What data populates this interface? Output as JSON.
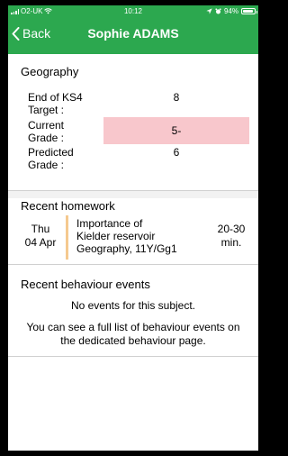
{
  "status_bar": {
    "carrier": "O2-UK",
    "time": "10:12",
    "battery": "94%",
    "battery_level": 0.94
  },
  "nav": {
    "back_label": "Back",
    "title": "Sophie ADAMS"
  },
  "geography": {
    "title": "Geography",
    "rows": [
      {
        "label_line1": "End of KS4",
        "label_line2": "Target :",
        "value": "8",
        "highlight": false
      },
      {
        "label_line1": "Current",
        "label_line2": "Grade :",
        "value": "5-",
        "highlight": true
      },
      {
        "label_line1": "Predicted",
        "label_line2": "Grade :",
        "value": "6",
        "highlight": false
      }
    ]
  },
  "homework": {
    "title": "Recent homework",
    "day": "Thu",
    "date": "04 Apr",
    "title_line1": "Importance of",
    "title_line2": "Kielder reservoir",
    "class_line": "Geography, 11Y/Gg1",
    "duration_line1": "20-30",
    "duration_line2": "min."
  },
  "behaviour": {
    "title": "Recent behaviour events",
    "no_events": "No events for this subject.",
    "note": "You can see a full list of behaviour events on the dedicated behaviour page."
  },
  "colors": {
    "brand_green": "#2ca84f",
    "highlight_pink": "#f8c7cc",
    "homework_bar": "#f5c98f"
  }
}
